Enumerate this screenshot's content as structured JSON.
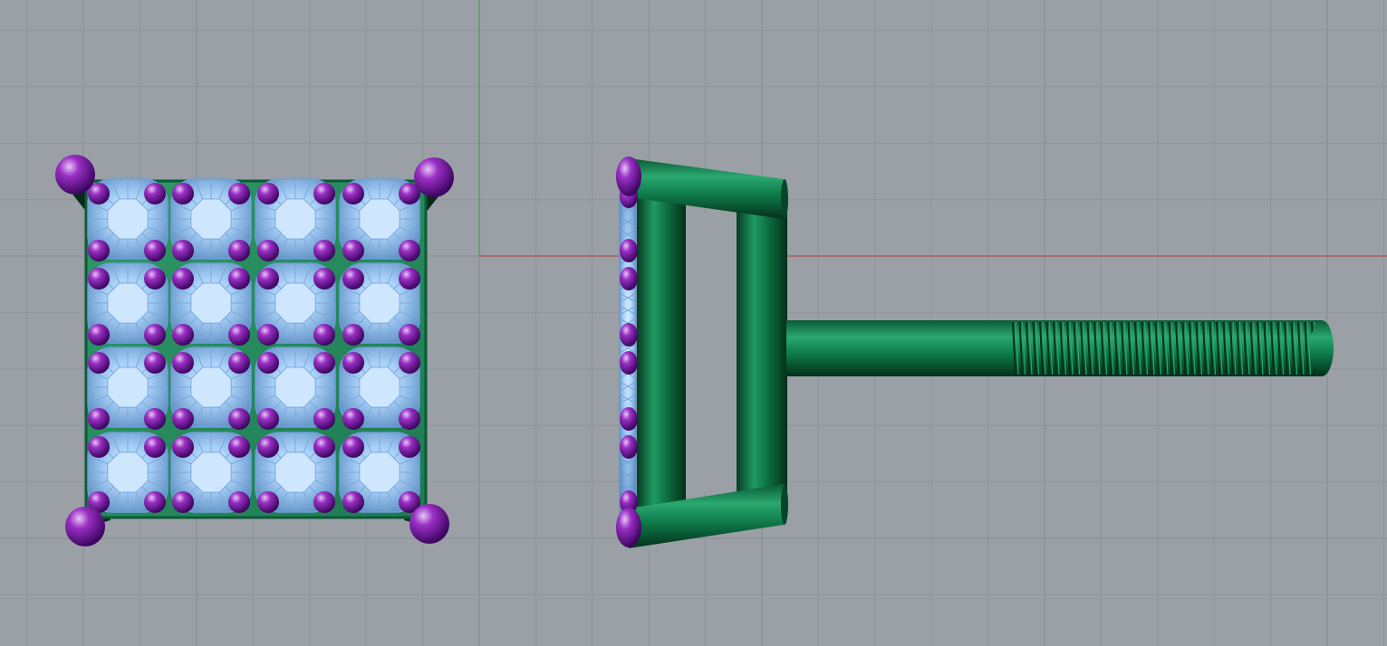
{
  "viewport": {
    "background": "#9aa0a6",
    "grid_minor_color": "#8e949a",
    "grid_major_color": "#868b91",
    "x_axis_color": "#b04040",
    "y_axis_color": "#3a9a3a"
  },
  "model": {
    "metal_color": "#0e7a4a",
    "prong_color": "#7a1aa0",
    "gem_color": "#9cc8f4",
    "front_view": {
      "stone_rows": 4,
      "stone_cols": 4
    },
    "side_view": {
      "has_threaded_post": true
    }
  }
}
